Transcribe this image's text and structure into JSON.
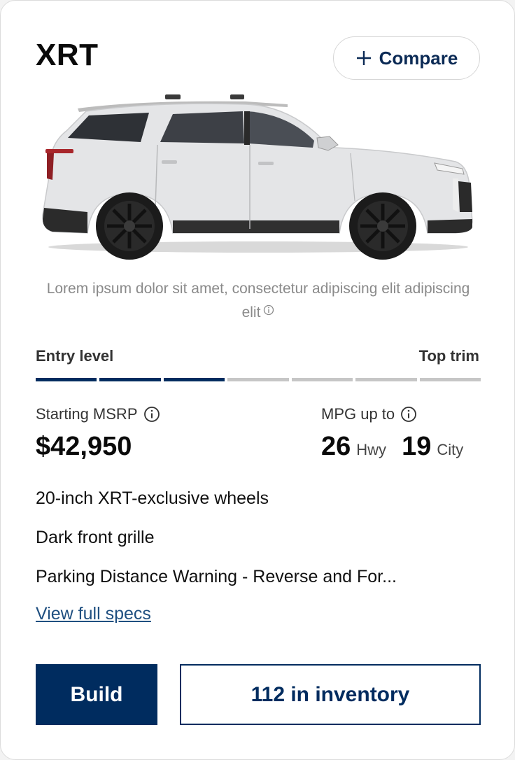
{
  "trim": {
    "name": "XRT",
    "compare_label": "Compare",
    "image_disclaimer": "Lorem ipsum dolor sit amet, consectetur adipiscing elit adipiscing elit"
  },
  "level": {
    "left_label": "Entry level",
    "right_label": "Top trim",
    "total_segments": 7,
    "filled_segments": 3
  },
  "price": {
    "label": "Starting MSRP",
    "value": "$42,950"
  },
  "mpg": {
    "label": "MPG up to",
    "hwy_value": "26",
    "hwy_unit": "Hwy",
    "city_value": "19",
    "city_unit": "City"
  },
  "features": [
    "20-inch XRT-exclusive wheels",
    "Dark front grille",
    "Parking Distance Warning - Reverse and For..."
  ],
  "links": {
    "view_specs": "View full specs"
  },
  "actions": {
    "build_label": "Build",
    "inventory_label": "112 in inventory"
  },
  "colors": {
    "brand_navy": "#002c5f",
    "inactive_segment": "#c6c6c6",
    "vehicle_body": "#e4e5e7"
  },
  "icons": [
    "plus-icon",
    "info-icon",
    "suv-vehicle-image"
  ]
}
